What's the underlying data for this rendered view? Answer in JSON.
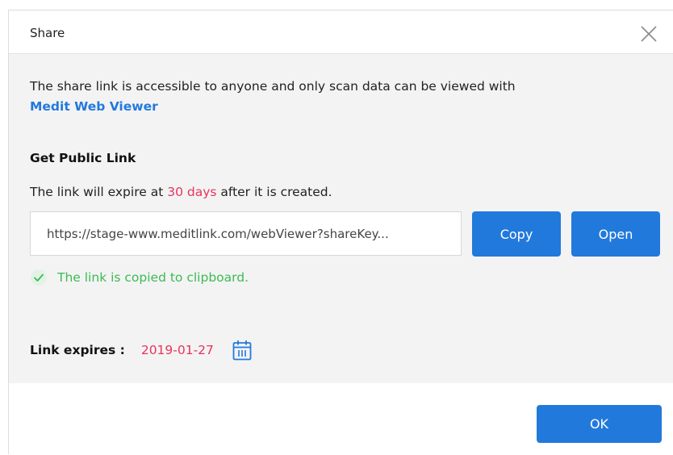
{
  "dialog": {
    "title": "Share",
    "description": "The share link is accessible to anyone and only scan data can be viewed with",
    "viewer_link": "Medit Web Viewer"
  },
  "public_link": {
    "heading": "Get Public Link",
    "expire_prefix": "The link will expire at ",
    "expire_days": "30 days",
    "expire_suffix": " after it is created.",
    "url": "https://stage-www.meditlink.com/webViewer?shareKey...",
    "copy_label": "Copy",
    "open_label": "Open",
    "copied_message": "The link is copied to clipboard."
  },
  "expiry": {
    "label": "Link expires :",
    "date": "2019-01-27"
  },
  "footer": {
    "ok_label": "OK"
  },
  "icons": {
    "close": "close-icon",
    "check": "check-icon",
    "calendar": "calendar-icon"
  },
  "colors": {
    "accent": "#2279dc",
    "highlight": "#e8345a",
    "success": "#3dbb53"
  }
}
